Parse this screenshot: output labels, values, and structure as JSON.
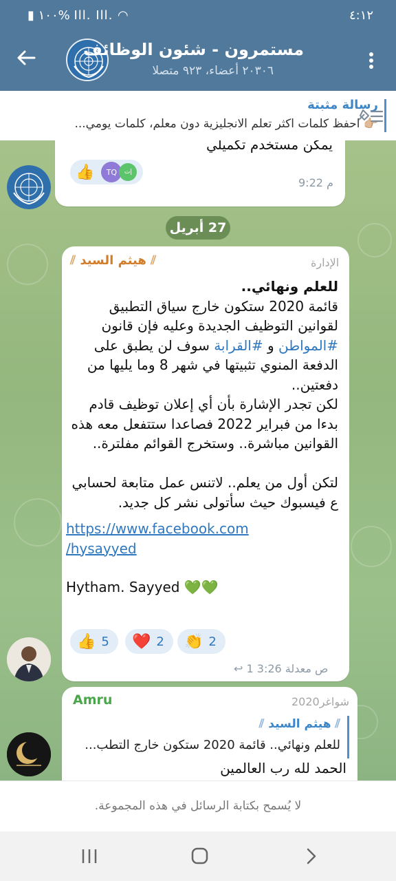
{
  "status_bar": {
    "time": "٤:١٢",
    "battery": "١٠٠%",
    "signal": "Ill. Ill."
  },
  "header": {
    "title": "مستمرون - شئون الوظائف",
    "subtitle": "٢٠٣٠٦ أعضاء، ٩٢٣ متصلا"
  },
  "pinned": {
    "title": "رسالة مثبتة",
    "text": "👉🏼 احفظ كلمات اكثر تعلم الانجليزية دون معلم، كلمات يومي..."
  },
  "messages": {
    "m1": {
      "partial_text": "يمكن مستخدم تكميلي",
      "time": "9:22 م",
      "reaction_avatars": [
        "TQ",
        "إت"
      ],
      "reaction_emoji": "👍"
    },
    "date_pill": "27 أبريل",
    "m2": {
      "sender": "هيثم السيد",
      "role": "الإدارة",
      "line1": "للعلم ونهائي..",
      "para1a": "قائمة 2020 ستكون خارج سياق التطبيق لقوانين التوظيف الجديدة وعليه فإن قانون ",
      "tag1": "#المواطن",
      "and": " و ",
      "tag2": "#القرابة",
      "para1b": " سوف لن يطبق على الدفعة المنوي تثبيتها في شهر 8 وما يليها من دفعتين..",
      "para2": "لكن تجدر الإشارة بأن أي إعلان توظيف قادم بدءا من فبراير 2022 فصاعدا  ستتفعل معه هذه القوانين مباشرة.. وستخرج القوائم مفلترة..",
      "para3": "لتكن أول من يعلم..  لاتنس عمل متابعة لحسابي ع فيسبوك حيث سأتولى نشر كل جديد.",
      "link_line1": "https://www.facebook.com",
      "link_line2": "/hysayyed",
      "signature": "Hytham. Sayyed 💚💚",
      "reactions": [
        {
          "emoji": "👍",
          "count": "5"
        },
        {
          "emoji": "❤️",
          "count": "2"
        },
        {
          "emoji": "👏",
          "count": "2"
        }
      ],
      "edited_label": "معدلة",
      "time": "3:26 ص",
      "forwards": "1"
    },
    "m3": {
      "sender": "Amru",
      "badge": "شواغر2020",
      "reply_name": "هيثم السيد",
      "reply_text": "للعلم ونهائي..   قائمة 2020 ستكون خارج التطب...",
      "text": "الحمد لله رب العالمين"
    }
  },
  "footer": {
    "notice": "لا يُسمح بكتابة الرسائل في هذه المجموعة."
  },
  "colors": {
    "header": "#50799c",
    "accent_link": "#2f78c0",
    "sender_name": "#d17d2a",
    "sender_green": "#4aa64a"
  }
}
